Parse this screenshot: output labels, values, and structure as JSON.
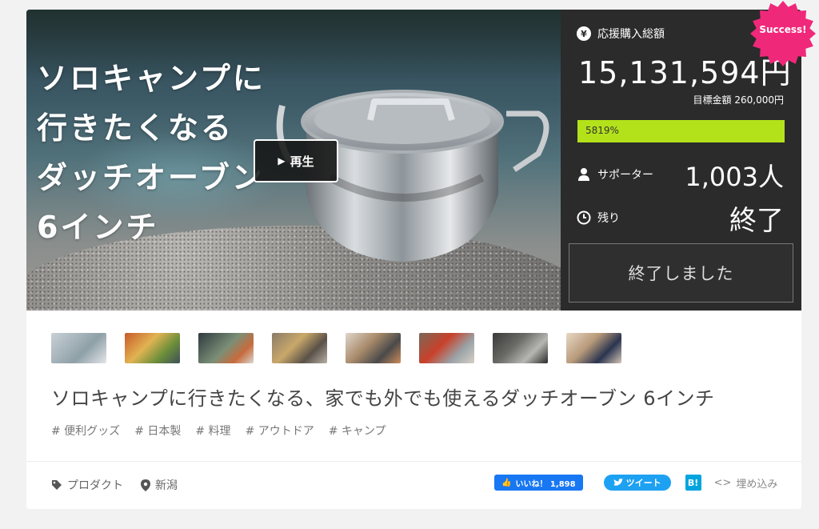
{
  "hero": {
    "title_lines": [
      "ソロキャンプに",
      "行きたくなる",
      "ダッチオーブン",
      "6インチ"
    ],
    "play_label": "再生",
    "play_icon": "play-icon"
  },
  "stats": {
    "total_label": "応援購入総額",
    "total_icon": "yen-icon",
    "total_value": "15,131,594円",
    "goal_text": "目標金額 260,000円",
    "progress_text": "5819%",
    "progress_fraction": 1.0,
    "progress_color": "#b4e21a",
    "supporters_label": "サポーター",
    "supporters_value": "1,003人",
    "remaining_label": "残り",
    "remaining_value": "終了",
    "ended_button": "終了しました"
  },
  "badge": {
    "text": "Success!",
    "color": "#f0287a"
  },
  "project": {
    "title": "ソロキャンプに行きたくなる、家でも外でも使えるダッチオーブン 6インチ",
    "tags": [
      "# 便利グッズ",
      "# 日本製",
      "# 料理",
      "# アウトドア",
      "# キャンプ"
    ]
  },
  "meta": {
    "category": "プロダクト",
    "location": "新潟"
  },
  "share": {
    "facebook_label": "いいね！ 1,898",
    "twitter_label": "ツイート",
    "hatena_label": "B!",
    "embed_label": "埋め込み"
  }
}
